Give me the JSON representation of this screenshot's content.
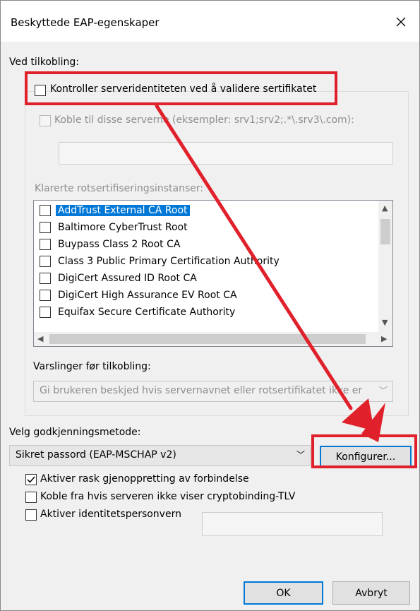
{
  "window": {
    "title": "Beskyttede EAP-egenskaper"
  },
  "connection": {
    "heading": "Ved tilkobling:",
    "validate_cert": {
      "label": "Kontroller serveridentiteten ved å validere sertifikatet",
      "checked": false
    },
    "connect_servers": {
      "label": "Koble til disse serverne (eksempler: srv1;srv2;.*\\.srv3\\.com):",
      "checked": false,
      "value": ""
    },
    "trusted_root_heading": "Klarerte rotsertifiseringsinstanser:",
    "trusted_roots": [
      {
        "label": "AddTrust External CA Root",
        "checked": false,
        "selected": true
      },
      {
        "label": "Baltimore CyberTrust Root",
        "checked": false,
        "selected": false
      },
      {
        "label": "Buypass Class 2 Root CA",
        "checked": false,
        "selected": false
      },
      {
        "label": "Class 3 Public Primary Certification Authority",
        "checked": false,
        "selected": false
      },
      {
        "label": "DigiCert Assured ID Root CA",
        "checked": false,
        "selected": false
      },
      {
        "label": "DigiCert High Assurance EV Root CA",
        "checked": false,
        "selected": false
      },
      {
        "label": "Equifax Secure Certificate Authority",
        "checked": false,
        "selected": false
      }
    ],
    "notifications_heading": "Varslinger før tilkobling:",
    "notifications_value": "Gi brukeren beskjed hvis servernavnet eller rotsertifikatet ikke er"
  },
  "auth": {
    "heading": "Velg godkjenningsmetode:",
    "method_value": "Sikret passord (EAP-MSCHAP v2)",
    "configure_label": "Konfigurer..."
  },
  "options": [
    {
      "label": "Aktiver rask gjenoppretting av forbindelse",
      "checked": true
    },
    {
      "label": "Koble fra hvis serveren ikke viser cryptobinding-TLV",
      "checked": false
    },
    {
      "label": "Aktiver identitetspersonvern",
      "checked": false
    }
  ],
  "buttons": {
    "ok": "OK",
    "cancel": "Avbryt"
  },
  "annotation_color": "#e0202a"
}
